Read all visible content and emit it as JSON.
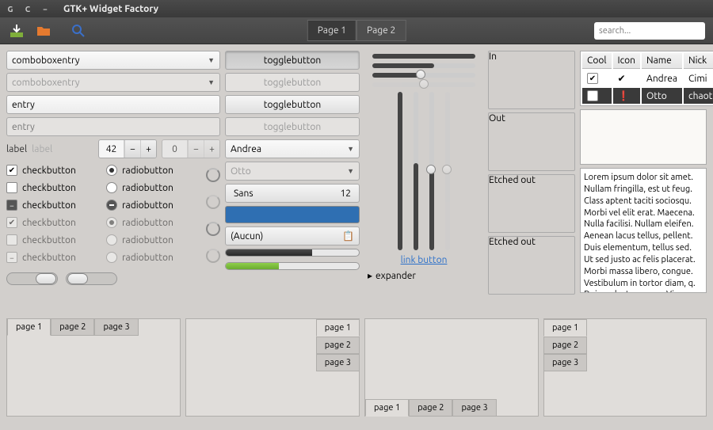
{
  "title": "GTK+ Widget Factory",
  "tabs": {
    "page1": "Page 1",
    "page2": "Page 2"
  },
  "search_placeholder": "search...",
  "col1": {
    "combo1": "comboboxentry",
    "combo2": "comboboxentry",
    "entry1": "entry",
    "entry2_placeholder": "entry",
    "label1": "label",
    "label2": "label",
    "spin1": "42",
    "spin2": "0",
    "checks": [
      "checkbutton",
      "checkbutton",
      "checkbutton",
      "checkbutton",
      "checkbutton",
      "checkbutton"
    ],
    "radios": [
      "radiobutton",
      "radiobutton",
      "radiobutton",
      "radiobutton",
      "radiobutton",
      "radiobutton"
    ]
  },
  "col2": {
    "toggles": [
      "togglebutton",
      "togglebutton",
      "togglebutton",
      "togglebutton"
    ],
    "combo_a": "Andrea",
    "combo_b": "Otto",
    "font_name": "Sans",
    "font_size": "12",
    "file_label": "(Aucun)"
  },
  "col3": {
    "link": "link button",
    "expander": "expander"
  },
  "frames": {
    "in": "In",
    "out": "Out",
    "e1": "Etched out",
    "e2": "Etched out"
  },
  "table": {
    "headers": [
      "Cool",
      "Icon",
      "Name",
      "Nick"
    ],
    "rows": [
      {
        "cool": true,
        "icon": "check",
        "name": "Andrea",
        "nick": "Cimi"
      },
      {
        "cool": false,
        "icon": "warn",
        "name": "Otto",
        "nick": "chaotic"
      }
    ]
  },
  "lorem": "Lorem ipsum dolor sit amet. Nullam fringilla, est ut feug. Class aptent taciti sociosqu. Morbi vel elit erat. Maecena. Nulla facilisi. Nullam eleifen. Aenean lacus tellus, pellent. Duis elementum, tellus sed. Ut sed justo ac felis placerat. Morbi massa libero, congue. Vestibulum in tortor diam, q. Duis eu lectus quam. Vivamu",
  "nb": {
    "p1": "page 1",
    "p2": "page 2",
    "p3": "page 3"
  }
}
